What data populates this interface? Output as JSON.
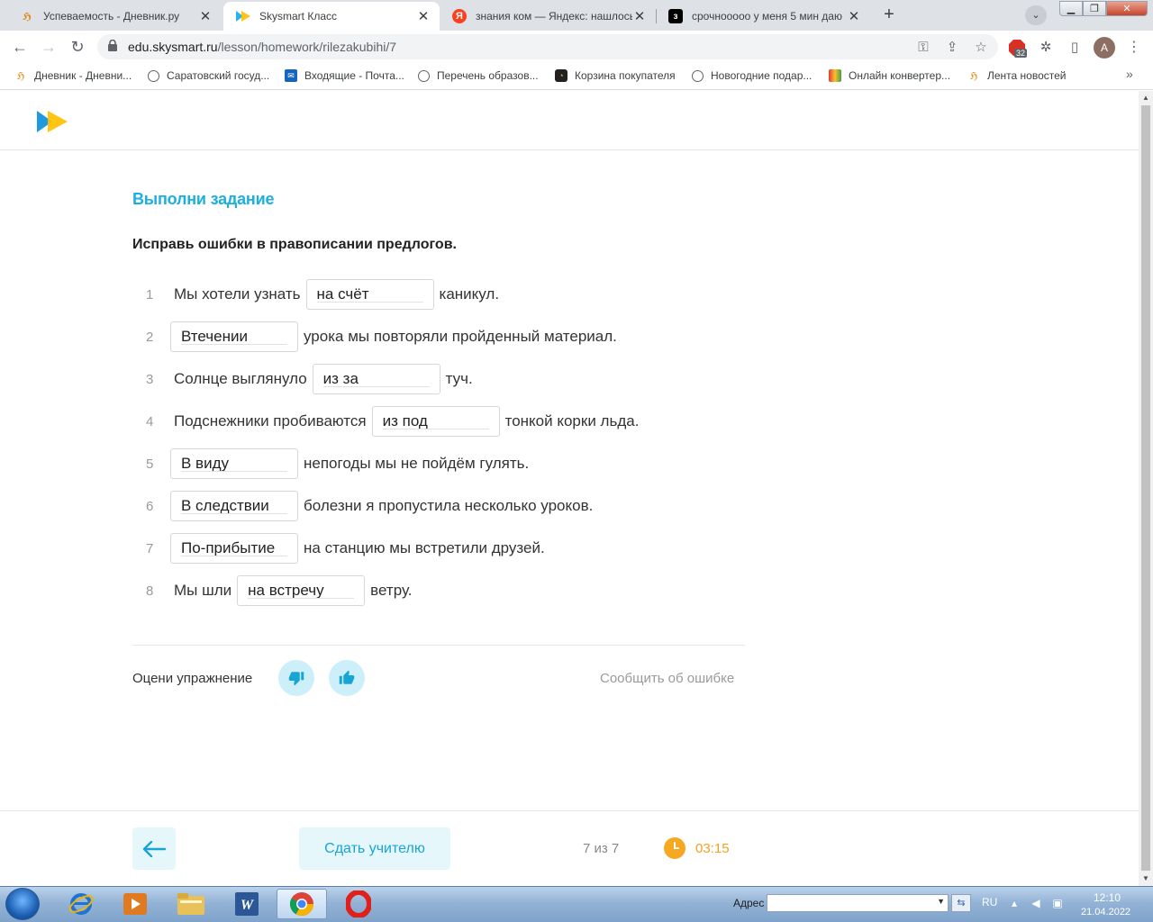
{
  "browser": {
    "tabs": [
      {
        "title": "Успеваемость - Дневник.ру",
        "icon": "dnevnik-icon",
        "active": false
      },
      {
        "title": "Skysmart Класс",
        "icon": "skysmart-icon",
        "active": true
      },
      {
        "title": "знания ком — Яндекс: нашлось",
        "icon": "yandex-icon",
        "active": false
      },
      {
        "title": "срочнооооо у меня 5 мин даю",
        "icon": "znanija-icon",
        "active": false
      }
    ],
    "url_host": "edu.skysmart.ru",
    "url_path": "/lesson/homework/rilezakubihi/7",
    "extension_badge": "32",
    "profile_initial": "A",
    "bookmarks": [
      {
        "label": "Дневник - Дневни..."
      },
      {
        "label": "Саратовский госуд..."
      },
      {
        "label": "Входящие - Почта..."
      },
      {
        "label": "Перечень образов..."
      },
      {
        "label": "Корзина покупателя"
      },
      {
        "label": "Новогодние подар..."
      },
      {
        "label": "Онлайн конвертер..."
      },
      {
        "label": "Лента новостей"
      }
    ]
  },
  "page": {
    "task_title": "Выполни задание",
    "instruction": "Исправь ошибки в правописании предлогов.",
    "rows": [
      {
        "num": "1",
        "before": "Мы хотели узнать",
        "answer": "на счёт",
        "after": "каникул."
      },
      {
        "num": "2",
        "before": "",
        "answer": "Втечении",
        "after": "урока мы повторяли пройденный материал."
      },
      {
        "num": "3",
        "before": "Солнце выглянуло",
        "answer": "из за",
        "after": "туч."
      },
      {
        "num": "4",
        "before": "Подснежники пробиваются",
        "answer": "из под",
        "after": "тонкой корки льда."
      },
      {
        "num": "5",
        "before": "",
        "answer": "В виду",
        "after": "непогоды мы не пойдём гулять."
      },
      {
        "num": "6",
        "before": "",
        "answer": "В следствии",
        "after": "болезни я пропустила несколько уроков."
      },
      {
        "num": "7",
        "before": "",
        "answer": "По-прибытие",
        "after": "на станцию мы встретили друзей."
      },
      {
        "num": "8",
        "before": "Мы шли",
        "answer": "на встречу",
        "after": "ветру."
      }
    ],
    "rate_label": "Оцени упражнение",
    "report_label": "Сообщить об ошибке",
    "submit_label": "Сдать учителю",
    "progress": "7 из 7",
    "timer": "03:15",
    "colors": {
      "accent": "#1cb0e0",
      "timer": "#f7a823",
      "button_bg": "#e6f7fc"
    }
  },
  "taskbar": {
    "address_label": "Адрес",
    "lang": "RU",
    "time": "12:10",
    "date": "21.04.2022"
  }
}
